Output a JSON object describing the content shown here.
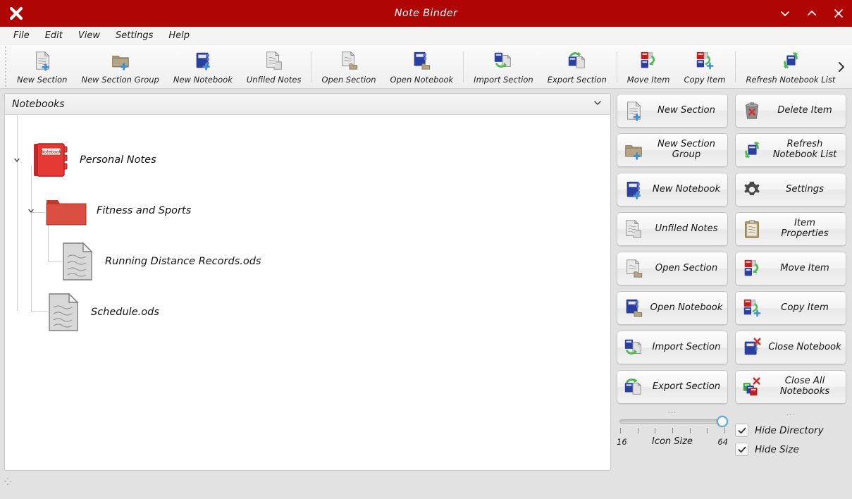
{
  "window": {
    "title": "Note Binder",
    "app_icon": "close-x-icon",
    "titlebar_color": "#b00505",
    "controls": [
      {
        "name": "minimize-button",
        "glyph": "chevron-down-icon"
      },
      {
        "name": "maximize-button",
        "glyph": "chevron-up-icon"
      },
      {
        "name": "close-button",
        "glyph": "close-x-icon"
      }
    ]
  },
  "menubar": {
    "items": [
      {
        "label": "File"
      },
      {
        "label": "Edit"
      },
      {
        "label": "View"
      },
      {
        "label": "Settings"
      },
      {
        "label": "Help"
      }
    ]
  },
  "toolbar": {
    "overflow_glyph": "chevron-right-icon",
    "groups": [
      {
        "items": [
          {
            "label": "New Section",
            "icon": "new-section-icon"
          },
          {
            "label": "New Section Group",
            "icon": "new-section-group-icon"
          },
          {
            "label": "New Notebook",
            "icon": "new-notebook-icon"
          },
          {
            "label": "Unfiled Notes",
            "icon": "unfiled-notes-icon"
          }
        ]
      },
      {
        "items": [
          {
            "label": "Open Section",
            "icon": "open-section-icon"
          },
          {
            "label": "Open Notebook",
            "icon": "open-notebook-icon"
          }
        ]
      },
      {
        "items": [
          {
            "label": "Import Section",
            "icon": "import-section-icon"
          },
          {
            "label": "Export Section",
            "icon": "export-section-icon"
          }
        ]
      },
      {
        "items": [
          {
            "label": "Move Item",
            "icon": "move-item-icon"
          },
          {
            "label": "Copy Item",
            "icon": "copy-item-icon"
          }
        ]
      },
      {
        "items": [
          {
            "label": "Refresh Notebook List",
            "icon": "refresh-notebook-list-icon"
          }
        ]
      }
    ]
  },
  "tree": {
    "header_label": "Notebooks",
    "header_chevron": "chevron-down-icon",
    "nodes": [
      {
        "label": "Personal Notes",
        "icon": "notebook-icon",
        "expander": "chevron-down-icon",
        "depth": 0
      },
      {
        "label": "Fitness and Sports",
        "icon": "folder-icon",
        "expander": "chevron-down-icon",
        "depth": 1
      },
      {
        "label": "Running Distance Records.ods",
        "icon": "document-icon",
        "expander": "",
        "depth": 2
      },
      {
        "label": "Schedule.ods",
        "icon": "document-icon",
        "expander": "",
        "depth": 1
      }
    ]
  },
  "commands": {
    "buttons": [
      {
        "label": "New Section",
        "icon": "new-section-icon"
      },
      {
        "label": "Delete Item",
        "icon": "delete-item-icon"
      },
      {
        "label": "New Section\nGroup",
        "icon": "new-section-group-icon"
      },
      {
        "label": "Refresh\nNotebook List",
        "icon": "refresh-notebook-list-icon"
      },
      {
        "label": "New Notebook",
        "icon": "new-notebook-icon"
      },
      {
        "label": "Settings",
        "icon": "gear-icon"
      },
      {
        "label": "Unfiled Notes",
        "icon": "unfiled-notes-icon"
      },
      {
        "label": "Item\nProperties",
        "icon": "item-properties-icon"
      },
      {
        "label": "Open Section",
        "icon": "open-section-icon"
      },
      {
        "label": "Move Item",
        "icon": "move-item-icon"
      },
      {
        "label": "Open Notebook",
        "icon": "open-notebook-icon"
      },
      {
        "label": "Copy Item",
        "icon": "copy-item-icon"
      },
      {
        "label": "Import Section",
        "icon": "import-section-icon"
      },
      {
        "label": "Close Notebook",
        "icon": "close-notebook-icon"
      },
      {
        "label": "Export Section",
        "icon": "export-section-icon"
      },
      {
        "label": "Close All\nNotebooks",
        "icon": "close-all-notebooks-icon"
      }
    ]
  },
  "icon_size": {
    "label": "Icon Size",
    "min": "16",
    "max": "64",
    "value": 64,
    "ticks": 7,
    "dots": "..."
  },
  "options": {
    "dots": "...",
    "hide_directory": {
      "label": "Hide Directory",
      "checked": true
    },
    "hide_size": {
      "label": "Hide Size",
      "checked": true
    }
  },
  "statusbar": {
    "text": ""
  }
}
